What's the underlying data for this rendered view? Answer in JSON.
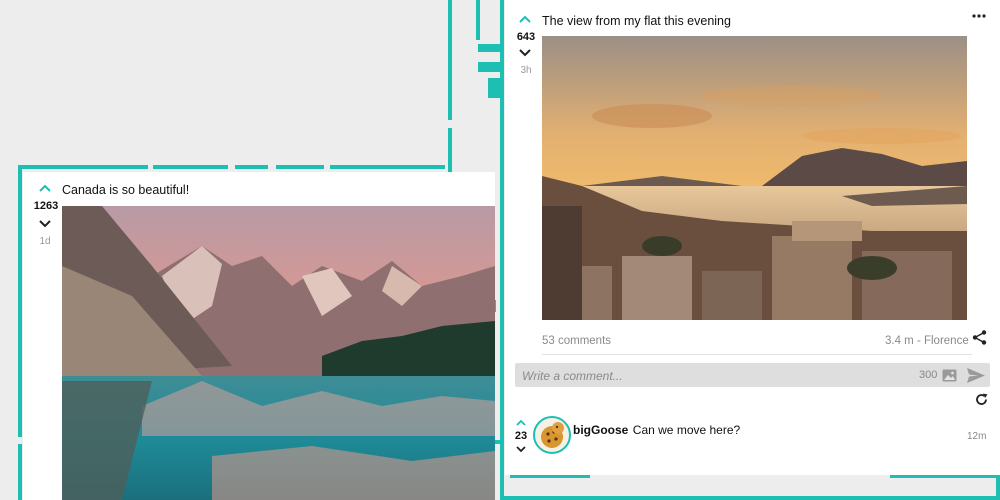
{
  "colors": {
    "accent": "#1dbfb3",
    "background": "#ededed",
    "card": "#ffffff",
    "muted": "#8a8a8a"
  },
  "post_left": {
    "title": "Canada is so beautiful!",
    "score": "1263",
    "age": "1d",
    "image_alt": "Mountain lake at sunset"
  },
  "post_right": {
    "title": "The view from my flat this evening",
    "score": "643",
    "age": "3h",
    "image_alt": "Sunset over a coastal city",
    "comments_count": "53 comments",
    "distance_location": "3.4 m - Florence",
    "comment_input": {
      "placeholder": "Write a comment...",
      "char_limit": "300"
    },
    "comments": [
      {
        "user": "bigGoose",
        "text": "Can we move here?",
        "score": "23",
        "time": "12m"
      }
    ]
  },
  "icons": [
    "upvote-icon",
    "downvote-icon",
    "more-options-icon",
    "share-icon",
    "image-icon",
    "send-icon",
    "refresh-icon"
  ]
}
